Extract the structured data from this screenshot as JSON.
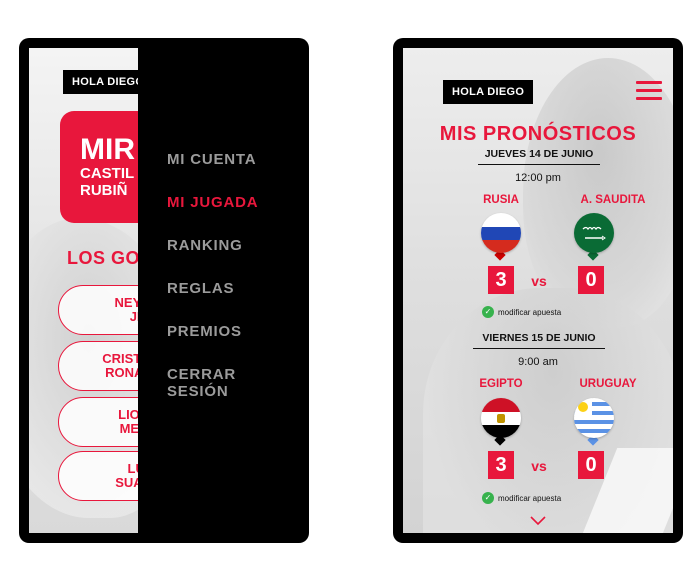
{
  "left_phone": {
    "greeting": "HOLA DIEGO",
    "card": {
      "line1": "MIR",
      "line2": "CASTIL",
      "line3": "RUBIÑ"
    },
    "section_title": "LOS GO",
    "players": [
      {
        "line1": "NEYMA",
        "line2": "JR"
      },
      {
        "line1": "CRISTIANO",
        "line2": "RONALDO"
      },
      {
        "line1": "LIONE",
        "line2": "MESS"
      },
      {
        "line1": "LUI",
        "line2": "SUARE"
      }
    ],
    "menu": {
      "items": [
        "MI CUENTA",
        "MI JUGADA",
        "RANKING",
        "REGLAS",
        "PREMIOS",
        "CERRAR SESIÓN"
      ],
      "active": "MI JUGADA"
    }
  },
  "right_phone": {
    "greeting": "HOLA DIEGO",
    "title": "MIS PRONÓSTICOS",
    "matches": [
      {
        "date": "JUEVES 14 DE JUNIO",
        "time": "12:00 pm",
        "home": "RUSIA",
        "away": "A. SAUDITA",
        "home_score": "3",
        "away_score": "0",
        "vs": "vs",
        "action": "modificar apuesta"
      },
      {
        "date": "VIERNES 15 DE JUNIO",
        "time": "9:00 am",
        "home": "EGIPTO",
        "away": "URUGUAY",
        "home_score": "3",
        "away_score": "0",
        "vs": "vs",
        "action": "modificar apuesta"
      }
    ]
  },
  "colors": {
    "accent": "#e8173c",
    "menu_bg": "#000000",
    "menu_text": "#9b9b9b",
    "check": "#37b24d"
  }
}
